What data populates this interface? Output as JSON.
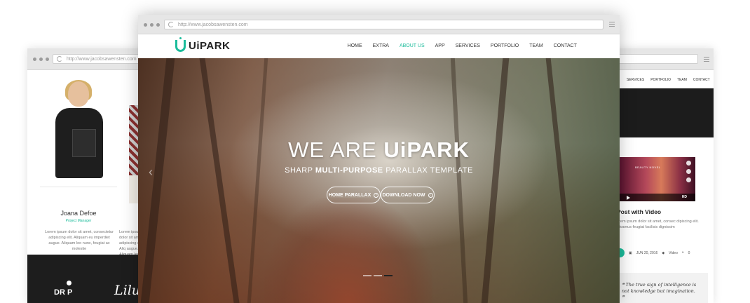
{
  "left_window": {
    "url": "http://www.jacobsawensten.com",
    "member": {
      "name": "Joana Defoe",
      "role": "Project Manager",
      "bio": "Lorem ipsum dolor sit amet, consectetur adipiscing elit. Aliquam eu imperdiet augue. Aliquam leo nunc, feugiat ac molestie",
      "bio_partial": "Lorem ipsum dolor sit amet, adipiscing elit. Aliq augue. Aliquam leo"
    },
    "brands": [
      "DR P",
      "Lilu"
    ]
  },
  "main_window": {
    "url": "http://www.jacobsawensten.com",
    "logo_text": "UiPARK",
    "nav": [
      "HOME",
      "EXTRA",
      "ABOUT US",
      "APP",
      "SERVICES",
      "PORTFOLIO",
      "TEAM",
      "CONTACT"
    ],
    "active_nav": "ABOUT US",
    "hero": {
      "title_light": "WE ARE",
      "title_bold": "UiPARK",
      "sub_light_1": "SHARP",
      "sub_bold": "MULTI-PURPOSE",
      "sub_light_2": "PARALLAX TEMPLATE",
      "button_1": "HOME PARALLAX",
      "button_2": "DOWNLOAD NOW",
      "slide_count": 3,
      "active_slide": 3
    }
  },
  "right_window": {
    "nav": [
      "SERVICES",
      "PORTFOLIO",
      "TEAM",
      "CONTACT"
    ],
    "video_strip_text": "BEAUTY NOVEL",
    "video_badge": "HD",
    "post": {
      "title": "Post with Video",
      "excerpt": "orem ipsum dolor sit amet, consec dipiscing elit. Vivamus feugiat facilisis dignissim",
      "date": "JUN 20, 2016",
      "category": "Video",
      "comments": "0"
    },
    "quote": "The true sign of intelligence is not knowledge but imagination."
  },
  "colors": {
    "accent": "#1bbc9b",
    "dark": "#1c1c1c"
  }
}
